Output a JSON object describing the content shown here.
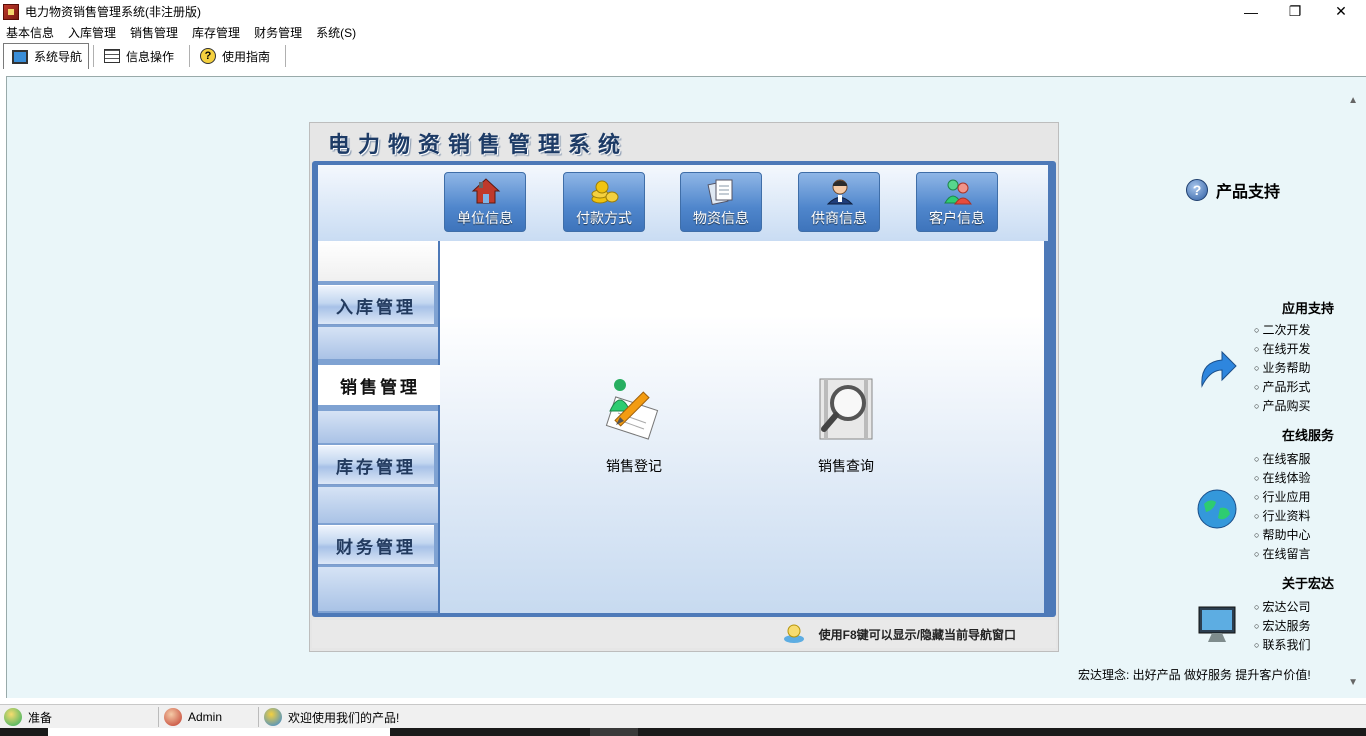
{
  "window": {
    "title": "电力物资销售管理系统(非注册版)",
    "minimize_glyph": "—",
    "maximize_glyph": "❐",
    "close_glyph": "✕"
  },
  "menu": [
    "基本信息",
    "入库管理",
    "销售管理",
    "库存管理",
    "财务管理",
    "系统(S)"
  ],
  "toolbar": {
    "tabs": [
      {
        "label": "系统导航",
        "icon": "monitor-icon",
        "active": true
      },
      {
        "label": "信息操作",
        "icon": "grid-icon",
        "active": false
      },
      {
        "label": "使用指南",
        "icon": "help-icon",
        "active": false
      }
    ]
  },
  "nav": {
    "title": "电力物资销售管理系统",
    "top_buttons": [
      {
        "label": "单位信息",
        "icon": "house-icon"
      },
      {
        "label": "付款方式",
        "icon": "coins-icon"
      },
      {
        "label": "物资信息",
        "icon": "documents-icon"
      },
      {
        "label": "供商信息",
        "icon": "person-icon"
      },
      {
        "label": "客户信息",
        "icon": "people-icon"
      }
    ],
    "sidebar": {
      "inbound": "入库管理",
      "sales": "销售管理",
      "inventory": "库存管理",
      "finance": "财务管理"
    },
    "features": [
      {
        "label": "销售登记",
        "icon": "pencil-icon"
      },
      {
        "label": "销售查询",
        "icon": "magnifier-icon"
      }
    ],
    "hint": "使用F8键可以显示/隐藏当前导航窗口"
  },
  "support": {
    "title": "产品支持",
    "sections": [
      {
        "title": "应用支持",
        "items": [
          "二次开发",
          "在线开发",
          "业务帮助",
          "产品形式",
          "产品购买"
        ]
      },
      {
        "title": "在线服务",
        "items": [
          "在线客服",
          "在线体验",
          "行业应用",
          "行业资料",
          "帮助中心",
          "在线留言"
        ]
      },
      {
        "title": "关于宏达",
        "items": [
          "宏达公司",
          "宏达服务",
          "联系我们"
        ]
      }
    ],
    "motto": "宏达理念: 出好产品 做好服务 提升客户价值!"
  },
  "statusbar": {
    "ready": "准备",
    "user": "Admin",
    "welcome": "欢迎使用我们的产品!"
  },
  "colors": {
    "frame_blue": "#4d79b8",
    "tile_blue": "#4f86cc",
    "main_bg": "#eaf6f9"
  }
}
